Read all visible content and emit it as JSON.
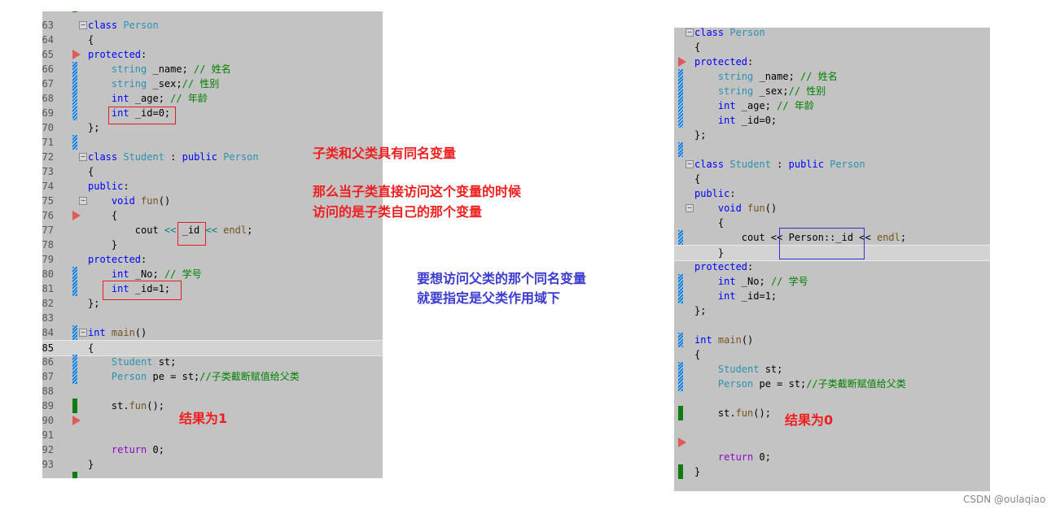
{
  "left_editor": {
    "first_line_number": 63,
    "current_line": 85,
    "lines": [
      [
        [
          "kw",
          "class "
        ],
        [
          "ty",
          "Person"
        ]
      ],
      [
        [
          "tx",
          "{"
        ]
      ],
      [
        [
          "kw",
          "protected"
        ],
        [
          "tx",
          ":"
        ]
      ],
      [
        [
          "ty",
          "    string"
        ],
        [
          "tx",
          " _name; "
        ],
        [
          "cm",
          "// 姓名"
        ]
      ],
      [
        [
          "ty",
          "    string"
        ],
        [
          "tx",
          " _sex;"
        ],
        [
          "cm",
          "// 性别"
        ]
      ],
      [
        [
          "kw",
          "    int"
        ],
        [
          "tx",
          " _age; "
        ],
        [
          "cm",
          "// 年龄"
        ]
      ],
      [
        [
          "kw",
          "    int"
        ],
        [
          "tx",
          " _id=0;"
        ]
      ],
      [
        [
          "tx",
          "};"
        ]
      ],
      [],
      [
        [
          "kw",
          "class "
        ],
        [
          "ty",
          "Student"
        ],
        [
          "tx",
          " : "
        ],
        [
          "kw",
          "public "
        ],
        [
          "ty",
          "Person"
        ]
      ],
      [
        [
          "tx",
          "{"
        ]
      ],
      [
        [
          "kw",
          "public"
        ],
        [
          "tx",
          ":"
        ]
      ],
      [
        [
          "kw",
          "    void "
        ],
        [
          "fn",
          "fun"
        ],
        [
          "tx",
          "()"
        ]
      ],
      [
        [
          "tx",
          "    {"
        ]
      ],
      [
        [
          "tx",
          "        cout "
        ],
        [
          "op",
          "<<"
        ],
        [
          "tx",
          " _id "
        ],
        [
          "op",
          "<<"
        ],
        [
          "fn",
          " endl"
        ],
        [
          "tx",
          ";"
        ]
      ],
      [
        [
          "tx",
          "    }"
        ]
      ],
      [
        [
          "kw",
          "protected"
        ],
        [
          "tx",
          ":"
        ]
      ],
      [
        [
          "kw",
          "    int"
        ],
        [
          "tx",
          " _No; "
        ],
        [
          "cm",
          "// 学号"
        ]
      ],
      [
        [
          "kw",
          "    int"
        ],
        [
          "tx",
          " _id=1;"
        ]
      ],
      [
        [
          "tx",
          "};"
        ]
      ],
      [],
      [
        [
          "kw",
          "int "
        ],
        [
          "fn",
          "main"
        ],
        [
          "tx",
          "()"
        ]
      ],
      [
        [
          "tx",
          "{"
        ]
      ],
      [
        [
          "ty",
          "    Student"
        ],
        [
          "tx",
          " st;"
        ]
      ],
      [
        [
          "ty",
          "    Person"
        ],
        [
          "tx",
          " pe = st;"
        ],
        [
          "cm",
          "//子类截断赋值给父类"
        ]
      ],
      [],
      [
        [
          "tx",
          "    st."
        ],
        [
          "fn",
          "fun"
        ],
        [
          "tx",
          "();"
        ]
      ],
      [],
      [],
      [
        [
          "rt",
          "    return"
        ],
        [
          "tx",
          " 0;"
        ]
      ],
      [
        [
          "tx",
          "}"
        ]
      ]
    ]
  },
  "right_editor": {
    "highlighted_line_index": 15,
    "lines": [
      [
        [
          "kw",
          "class "
        ],
        [
          "ty",
          "Person"
        ]
      ],
      [
        [
          "tx",
          "{"
        ]
      ],
      [
        [
          "kw",
          "protected"
        ],
        [
          "tx",
          ":"
        ]
      ],
      [
        [
          "ty",
          "    string"
        ],
        [
          "tx",
          " _name; "
        ],
        [
          "cm",
          "// 姓名"
        ]
      ],
      [
        [
          "ty",
          "    string"
        ],
        [
          "tx",
          " _sex;"
        ],
        [
          "cm",
          "// 性别"
        ]
      ],
      [
        [
          "kw",
          "    int"
        ],
        [
          "tx",
          " _age; "
        ],
        [
          "cm",
          "// 年龄"
        ]
      ],
      [
        [
          "kw",
          "    int"
        ],
        [
          "tx",
          " _id=0;"
        ]
      ],
      [
        [
          "tx",
          "};"
        ]
      ],
      [],
      [
        [
          "kw",
          "class "
        ],
        [
          "ty",
          "Student"
        ],
        [
          "tx",
          " : "
        ],
        [
          "kw",
          "public "
        ],
        [
          "ty",
          "Person"
        ]
      ],
      [
        [
          "tx",
          "{"
        ]
      ],
      [
        [
          "kw",
          "public"
        ],
        [
          "tx",
          ":"
        ]
      ],
      [
        [
          "kw",
          "    void "
        ],
        [
          "fn",
          "fun"
        ],
        [
          "tx",
          "()"
        ]
      ],
      [
        [
          "tx",
          "    {"
        ]
      ],
      [
        [
          "tx",
          "        cout << Person::_id << "
        ],
        [
          "fn",
          "endl"
        ],
        [
          "tx",
          ";"
        ]
      ],
      [
        [
          "tx",
          "    }"
        ]
      ],
      [
        [
          "kw",
          "protected"
        ],
        [
          "tx",
          ":"
        ]
      ],
      [
        [
          "kw",
          "    int"
        ],
        [
          "tx",
          " _No; "
        ],
        [
          "cm",
          "// 学号"
        ]
      ],
      [
        [
          "kw",
          "    int"
        ],
        [
          "tx",
          " _id=1;"
        ]
      ],
      [
        [
          "tx",
          "};"
        ]
      ],
      [],
      [
        [
          "kw",
          "int "
        ],
        [
          "fn",
          "main"
        ],
        [
          "tx",
          "()"
        ]
      ],
      [
        [
          "tx",
          "{"
        ]
      ],
      [
        [
          "ty",
          "    Student"
        ],
        [
          "tx",
          " st;"
        ]
      ],
      [
        [
          "ty",
          "    Person"
        ],
        [
          "tx",
          " pe = st;"
        ],
        [
          "cm",
          "//子类截断赋值给父类"
        ]
      ],
      [],
      [
        [
          "tx",
          "    st."
        ],
        [
          "fn",
          "fun"
        ],
        [
          "tx",
          "();"
        ]
      ],
      [],
      [],
      [
        [
          "rt",
          "    return"
        ],
        [
          "tx",
          " 0;"
        ]
      ],
      [
        [
          "tx",
          "}"
        ]
      ]
    ]
  },
  "annotations": {
    "same_name": "子类和父类具有同名变量",
    "direct_access_1": "那么当子类直接访问这个变量的时候",
    "direct_access_2": "访问的是子类自己的那个变量",
    "parent_access_1": "要想访问父类的那个同名变量",
    "parent_access_2": "就要指定是父类作用域下",
    "result_left": "结果为1",
    "result_right": "结果为0"
  },
  "colors": {
    "annotation_red": "#f01e1e",
    "annotation_blue": "#3b3bd0",
    "keyword": "#0000ff",
    "type": "#2b91af",
    "comment": "#008000"
  },
  "watermark": "CSDN @oulaqiao"
}
